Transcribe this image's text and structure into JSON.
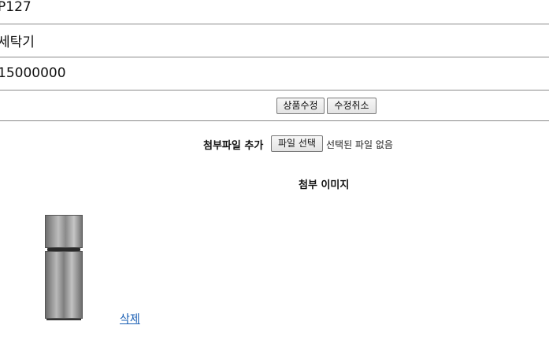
{
  "form": {
    "code_value": "P127",
    "name_value": "세탁기",
    "price_value": "15000000",
    "update_button": "상품수정",
    "cancel_button": "수정취소"
  },
  "upload": {
    "label": "첨부파일 추가",
    "file_button": "파일 선택",
    "status": "선택된 파일 없음"
  },
  "attachments": {
    "title": "첨부 이미지",
    "image_icon": "refrigerator-image",
    "delete_link": "삭제",
    "link_color": "#1a5fb4"
  }
}
